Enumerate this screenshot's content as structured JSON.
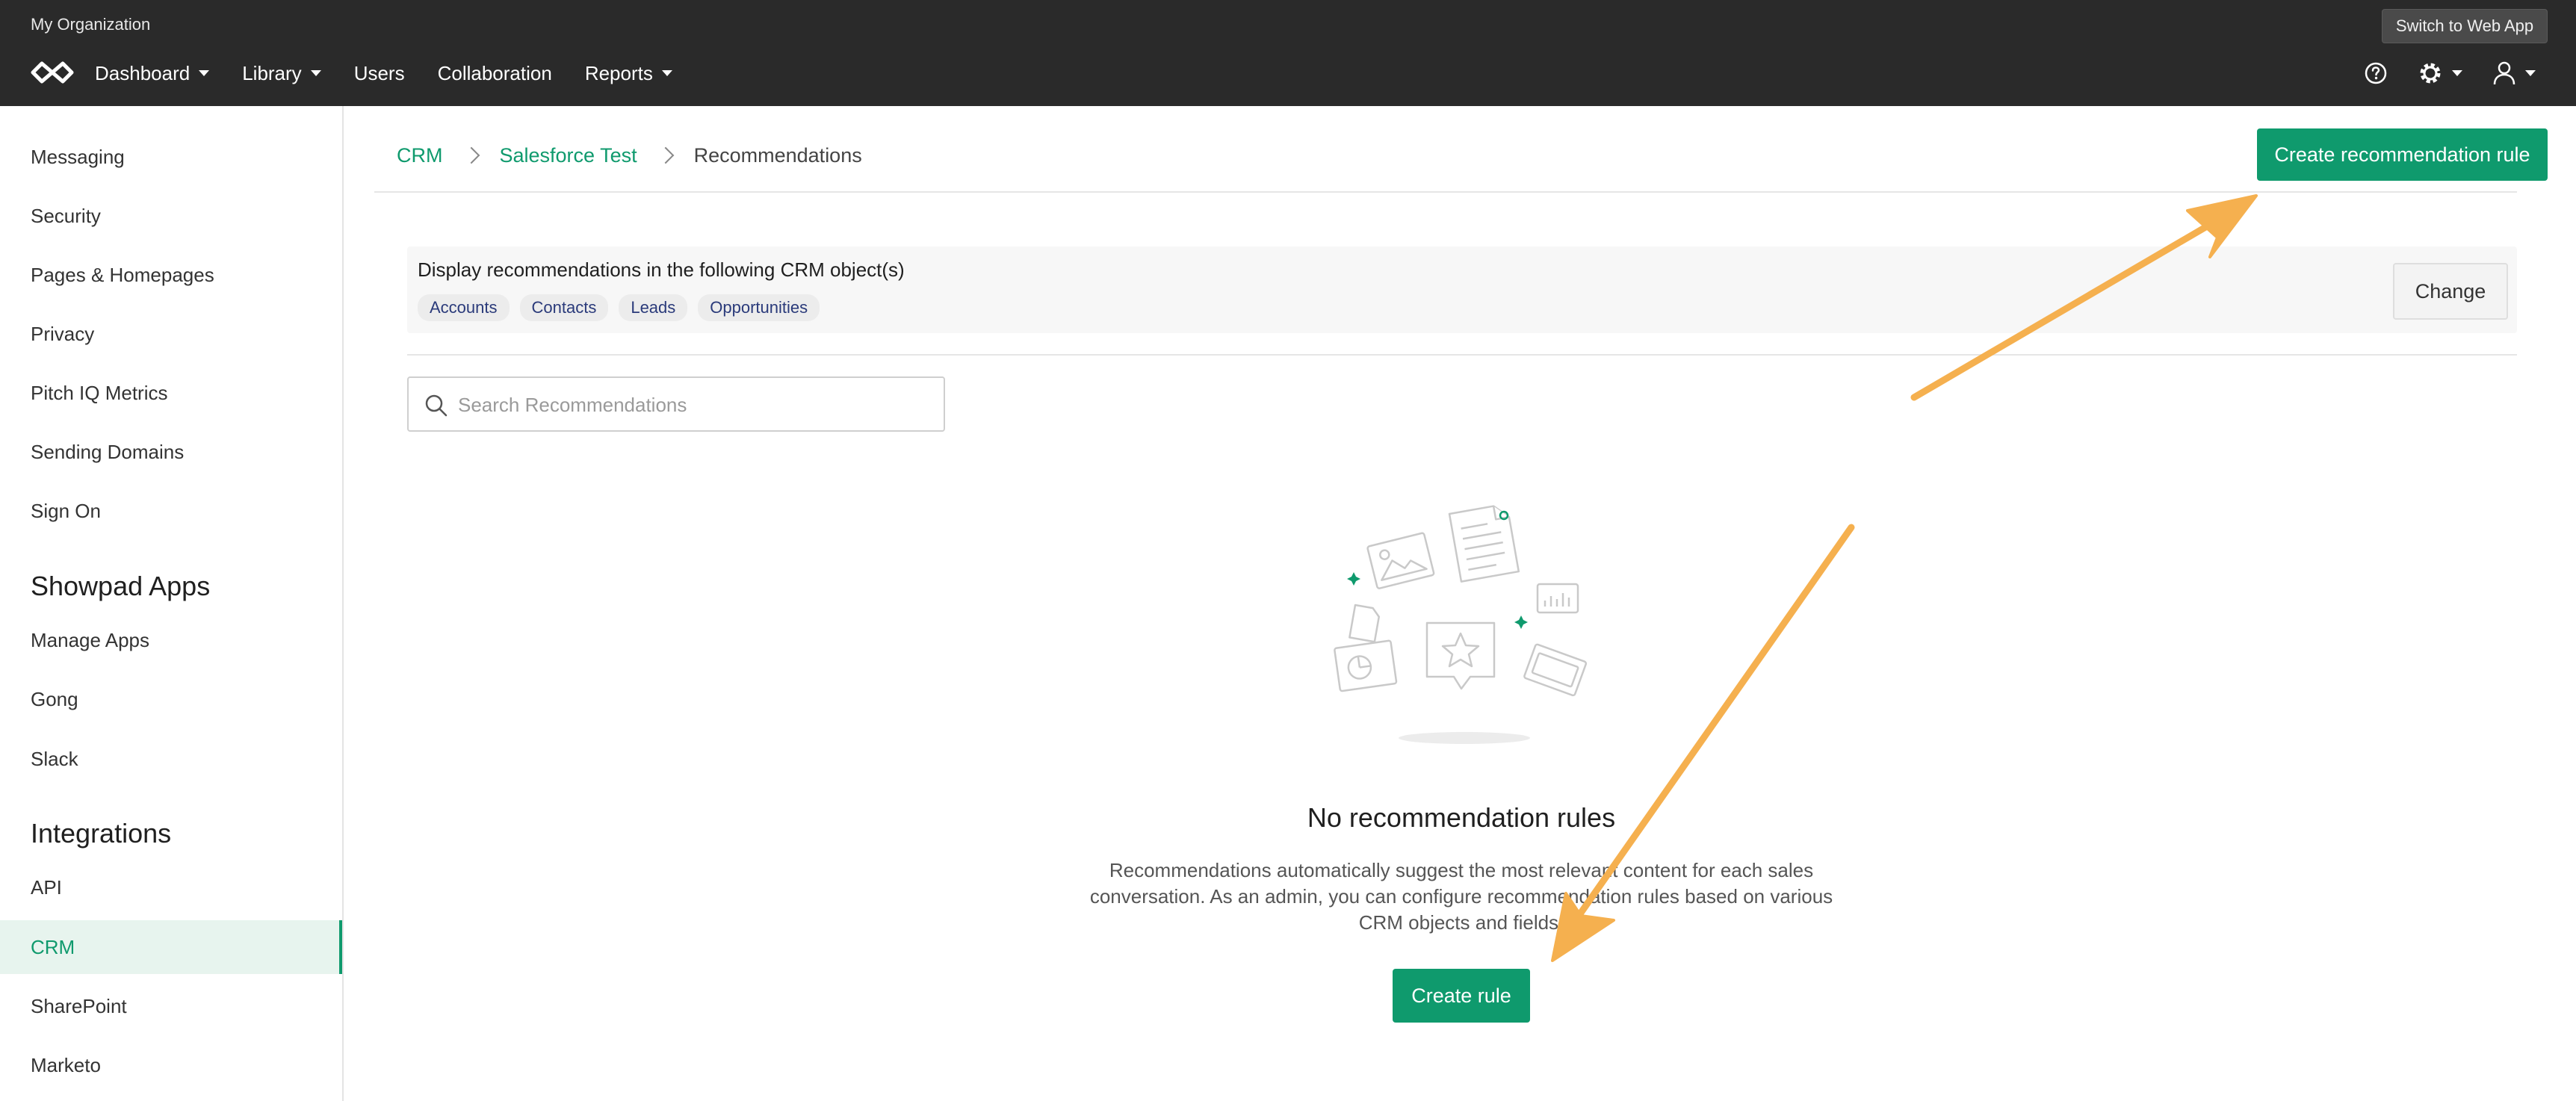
{
  "topbar": {
    "org_name": "My Organization",
    "switch_label": "Switch to Web App",
    "nav": [
      {
        "label": "Dashboard",
        "has_caret": true
      },
      {
        "label": "Library",
        "has_caret": true
      },
      {
        "label": "Users",
        "has_caret": false
      },
      {
        "label": "Collaboration",
        "has_caret": false
      },
      {
        "label": "Reports",
        "has_caret": true
      }
    ],
    "icons": [
      "help-icon",
      "settings-icon",
      "user-icon"
    ]
  },
  "sidebar": {
    "items": [
      {
        "label": "Messaging"
      },
      {
        "label": "Security"
      },
      {
        "label": "Pages & Homepages"
      },
      {
        "label": "Privacy"
      },
      {
        "label": "Pitch IQ Metrics"
      },
      {
        "label": "Sending Domains"
      },
      {
        "label": "Sign On"
      }
    ],
    "apps_heading": "Showpad Apps",
    "apps": [
      {
        "label": "Manage Apps"
      },
      {
        "label": "Gong"
      },
      {
        "label": "Slack"
      }
    ],
    "integrations_heading": "Integrations",
    "integrations": [
      {
        "label": "API",
        "active": false
      },
      {
        "label": "CRM",
        "active": true
      },
      {
        "label": "SharePoint",
        "active": false
      },
      {
        "label": "Marketo",
        "active": false
      }
    ]
  },
  "breadcrumb": {
    "items": [
      "CRM",
      "Salesforce Test",
      "Recommendations"
    ]
  },
  "header": {
    "create_rule_label": "Create recommendation rule"
  },
  "crm_objects": {
    "title": "Display recommendations in the following CRM object(s)",
    "chips": [
      "Accounts",
      "Contacts",
      "Leads",
      "Opportunities"
    ],
    "change_label": "Change"
  },
  "search": {
    "placeholder": "Search Recommendations"
  },
  "empty_state": {
    "title": "No recommendation rules",
    "description": "Recommendations automatically suggest the most relevant content for each sales conversation. As an admin, you can configure recommendation rules based on various CRM objects and fields.",
    "button_label": "Create rule"
  },
  "colors": {
    "accent": "#0f9a6d",
    "topbar": "#2a2a2a",
    "annotation_arrow": "#f5b04f"
  }
}
